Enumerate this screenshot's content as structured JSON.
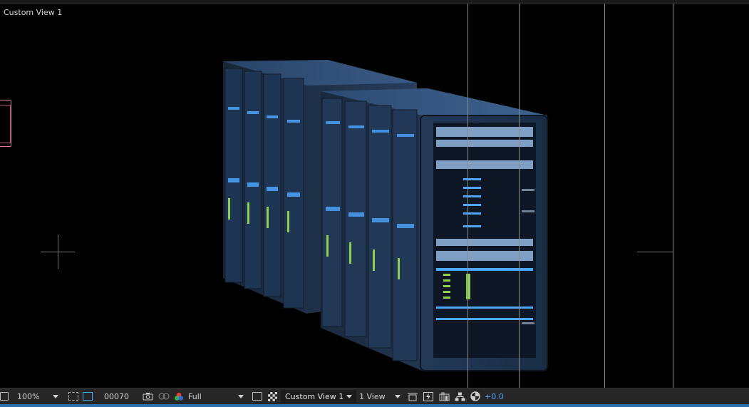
{
  "viewer": {
    "view_label": "Custom View 1"
  },
  "toolbar": {
    "zoom": "100%",
    "timecode": "00070",
    "resolution": "Full",
    "view_select": "Custom View 1",
    "layout_select": "1 View",
    "exposure": "+0.0"
  },
  "colors": {
    "accent": "#4ea6ff",
    "rack_body": "#1e2f45",
    "rack_face": "#2e4a6e",
    "led_blue": "#4da6ff",
    "led_green": "#8fd14f",
    "marker": "#d77a9a",
    "toolbar_bg": "#262626"
  },
  "icons": {
    "snapshot": "camera-icon",
    "channels": "color-channels-icon",
    "transparency": "checkerboard-icon",
    "region": "region-of-interest-icon",
    "fast_preview": "lightning-icon",
    "flowchart": "flowchart-icon"
  }
}
